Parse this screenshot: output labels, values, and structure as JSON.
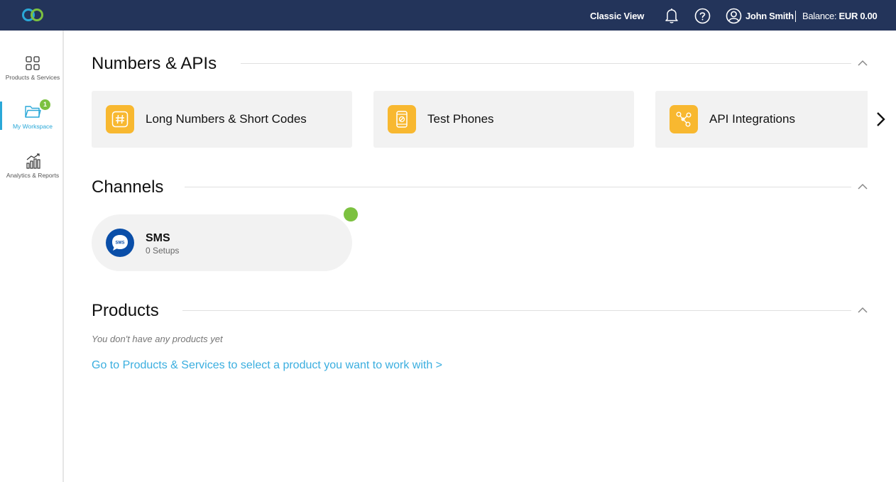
{
  "header": {
    "classic_view": "Classic View",
    "user_name": "John Smith",
    "balance_label": "Balance:",
    "balance_value": "EUR 0.00"
  },
  "sidebar": {
    "items": [
      {
        "label": "Products & Services",
        "icon": "grid-icon"
      },
      {
        "label": "My Workspace",
        "icon": "folder-icon",
        "badge": "1"
      },
      {
        "label": "Analytics & Reports",
        "icon": "chart-icon"
      }
    ]
  },
  "sections": {
    "numbers_apis": {
      "title": "Numbers & APIs",
      "cards": [
        {
          "label": "Long Numbers & Short Codes",
          "icon": "hash-icon"
        },
        {
          "label": "Test Phones",
          "icon": "phone-icon"
        },
        {
          "label": "API Integrations",
          "icon": "share-nodes-icon"
        }
      ]
    },
    "channels": {
      "title": "Channels",
      "sms": {
        "title": "SMS",
        "subtitle": "0 Setups",
        "icon_text": "SMS"
      }
    },
    "products": {
      "title": "Products",
      "empty_text": "You don't have any products yet",
      "link_text": "Go to Products & Services to select a product you want to work with >"
    }
  },
  "colors": {
    "header_bg": "#23345a",
    "accent": "#2aa8d8",
    "icon_yellow": "#f8b830",
    "status_green": "#7cc140",
    "sms_blue": "#0a4ea8"
  }
}
